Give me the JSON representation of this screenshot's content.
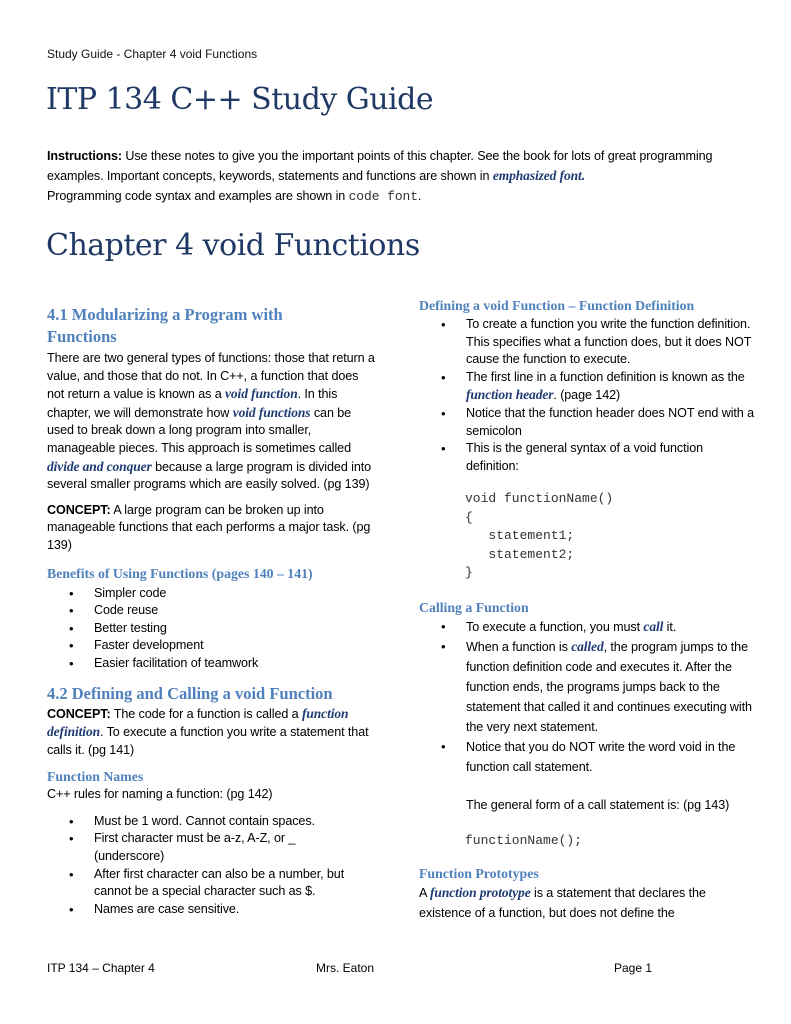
{
  "header": {
    "running_title": "Study Guide - Chapter 4 void Functions"
  },
  "title": "ITP 134 C++ Study Guide",
  "instructions": {
    "label": "Instructions:",
    "text1": "  Use these notes to give you the important points of this chapter.  See the book for lots of great programming examples.  Important concepts, keywords, statements and functions are shown in ",
    "emph": "emphasized font.",
    "text2": "Programming code syntax and examples are shown in ",
    "code": "code font",
    "text3": "."
  },
  "chapter_title": "Chapter 4 void Functions",
  "left": {
    "s41": {
      "heading": "4.1 Modularizing a Program with Functions",
      "p1": "There are two general types of functions: those that return a value, and those that do not.  In C++, a function that does not return a value is known as a ",
      "e1": "void function",
      "p2": ". In this chapter, we will demonstrate how ",
      "e2": "void functions",
      "p3": " can be used to break down a long program into smaller, manageable pieces. This approach is sometimes called ",
      "e3": "divide and conquer",
      "p4": " because a large program is divided into several smaller programs which are easily solved. (pg 139)",
      "concept_label": "CONCEPT:",
      "concept_text": " A large program can be broken up into manageable functions that each performs a major task. (pg 139)"
    },
    "benefits": {
      "heading": "Benefits of Using Functions (pages 140 – 141)",
      "items": [
        "Simpler code",
        "Code reuse",
        "Better testing",
        "Faster development",
        "Easier facilitation of teamwork"
      ]
    },
    "s42": {
      "heading": "4.2 Defining and Calling a void Function",
      "concept_label": "CONCEPT:",
      "c1": " The code for a function is called a ",
      "e1": "function definition",
      "c2": ".  To execute a function you write a statement that calls it. (pg 141)"
    },
    "names": {
      "heading": "Function Names",
      "intro": "C++ rules for naming a function: (pg 142)",
      "items": [
        "Must be 1 word.  Cannot  contain spaces.",
        "First character must be a-z, A-Z, or _ (underscore)",
        "After first character can also be a number, but cannot be a special character such as $.",
        "Names are case sensitive."
      ]
    }
  },
  "right": {
    "definition": {
      "heading": "Defining a void Function – Function Definition",
      "b1": "To create a function you write the function definition.  This specifies what a function does, but it does NOT cause the function to execute.",
      "b2a": "The first line in a function definition is known as the ",
      "b2e": "function header",
      "b2b": ".  (page 142)",
      "b3": "Notice that the function header does NOT end with a semicolon",
      "b4": "This is the general syntax of a void function definition:",
      "code": [
        "void functionName()",
        "{",
        "   statement1;",
        "   statement2;",
        "}"
      ]
    },
    "calling": {
      "heading": "Calling a Function",
      "b1a": "To execute a function, you must ",
      "b1e": "call",
      "b1b": " it.",
      "b2a": "When a function is ",
      "b2e": "called",
      "b2b": ", the program jumps to the function definition code and executes it. After the function ends, the programs jumps back to the statement that called it and continues executing with the very next statement.",
      "b3": " Notice that you do NOT write the word void in the function call statement.",
      "general_form": "The general form of a call statement is: (pg 143)",
      "code": "functionName();"
    },
    "prototypes": {
      "heading": "Function Prototypes",
      "p_a": "A ",
      "p_e": "function prototype",
      "p_b": " is a statement that declares the existence of a function, but does not define the"
    }
  },
  "footer": {
    "left": "ITP 134 – Chapter 4",
    "center": "Mrs. Eaton",
    "right": "Page 1"
  }
}
